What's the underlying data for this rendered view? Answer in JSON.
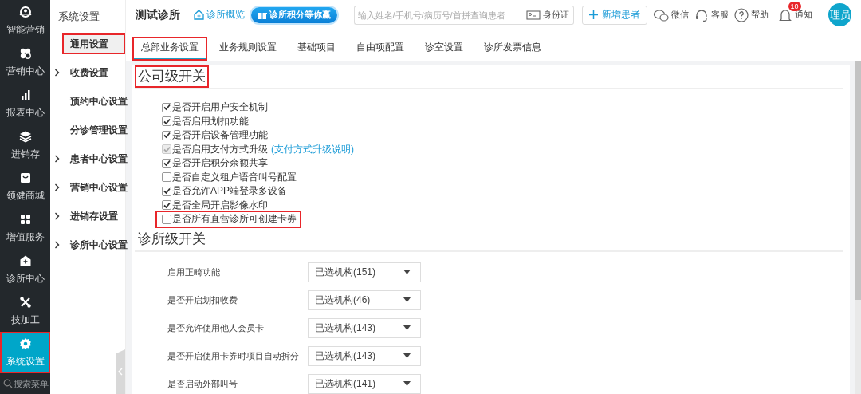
{
  "sidebar": {
    "items": [
      {
        "label": "智能营销",
        "selected": false,
        "highlighted": false
      },
      {
        "label": "营销中心",
        "selected": false,
        "highlighted": false
      },
      {
        "label": "报表中心",
        "selected": false,
        "highlighted": false
      },
      {
        "label": "进销存",
        "selected": false,
        "highlighted": false
      },
      {
        "label": "领健商城",
        "selected": false,
        "highlighted": false
      },
      {
        "label": "增值服务",
        "selected": false,
        "highlighted": false
      },
      {
        "label": "诊所中心",
        "selected": false,
        "highlighted": false
      },
      {
        "label": "技加工",
        "selected": false,
        "highlighted": false
      },
      {
        "label": "系统设置",
        "selected": true,
        "highlighted": true
      }
    ],
    "search": {
      "placeholder": "搜索菜单"
    }
  },
  "submenu": {
    "title": "系统设置",
    "items": [
      {
        "label": "通用设置",
        "expandable": false,
        "selected": true,
        "highlighted": true
      },
      {
        "label": "收费设置",
        "expandable": true,
        "selected": false,
        "highlighted": false
      },
      {
        "label": "预约中心设置",
        "expandable": false,
        "selected": false,
        "highlighted": false
      },
      {
        "label": "分诊管理设置",
        "expandable": false,
        "selected": false,
        "highlighted": false
      },
      {
        "label": "患者中心设置",
        "expandable": true,
        "selected": false,
        "highlighted": false
      },
      {
        "label": "营销中心设置",
        "expandable": true,
        "selected": false,
        "highlighted": false
      },
      {
        "label": "进销存设置",
        "expandable": true,
        "selected": false,
        "highlighted": false
      },
      {
        "label": "诊所中心设置",
        "expandable": true,
        "selected": false,
        "highlighted": false
      }
    ]
  },
  "topbar": {
    "clinic_name": "测试诊所",
    "overview_link": "诊所概览",
    "promo_banner": "诊所积分等你赢",
    "search": {
      "placeholder": "输入姓名/手机号/病历号/首拼查询患者"
    },
    "id_card_button": "身份证",
    "add_patient_button": "新增患者",
    "actions": [
      {
        "label": "微信"
      },
      {
        "label": "客服"
      },
      {
        "label": "帮助"
      },
      {
        "label": "通知",
        "badge": "10"
      }
    ],
    "avatar": "理员"
  },
  "tabs": [
    {
      "label": "总部业务设置",
      "selected": true,
      "highlighted": true
    },
    {
      "label": "业务规则设置",
      "selected": false,
      "highlighted": false
    },
    {
      "label": "基础项目",
      "selected": false,
      "highlighted": false
    },
    {
      "label": "自由项配置",
      "selected": false,
      "highlighted": false
    },
    {
      "label": "诊室设置",
      "selected": false,
      "highlighted": false
    },
    {
      "label": "诊所发票信息",
      "selected": false,
      "highlighted": false
    }
  ],
  "company_switches": {
    "title": "公司级开关",
    "highlighted": true,
    "items": [
      {
        "label": "是否开启用户安全机制",
        "checked": true,
        "disabled": false,
        "highlighted": false
      },
      {
        "label": "是否启用划扣功能",
        "checked": true,
        "disabled": false,
        "highlighted": false
      },
      {
        "label": "是否开启设备管理功能",
        "checked": true,
        "disabled": false,
        "highlighted": false
      },
      {
        "label": "是否启用支付方式升级",
        "link": "(支付方式升级说明)",
        "checked": true,
        "disabled": true,
        "highlighted": false
      },
      {
        "label": "是否开启积分余额共享",
        "checked": true,
        "disabled": false,
        "highlighted": false
      },
      {
        "label": "是否自定义租户语音叫号配置",
        "checked": false,
        "disabled": false,
        "highlighted": false
      },
      {
        "label": "是否允许APP端登录多设备",
        "checked": true,
        "disabled": false,
        "highlighted": false
      },
      {
        "label": "是否全局开启影像水印",
        "checked": true,
        "disabled": false,
        "highlighted": false
      },
      {
        "label": "是否所有直营诊所可创建卡券",
        "checked": false,
        "disabled": false,
        "highlighted": true
      }
    ]
  },
  "clinic_switches": {
    "title": "诊所级开关",
    "highlighted": false,
    "rows": [
      {
        "label": "启用正畸功能",
        "value": "已选机构(151)"
      },
      {
        "label": "是否开启划扣收费",
        "value": "已选机构(46)"
      },
      {
        "label": "是否允许使用他人会员卡",
        "value": "已选机构(143)"
      },
      {
        "label": "是否开启使用卡券时项目自动拆分",
        "value": "已选机构(143)"
      },
      {
        "label": "是否启动外部叫号",
        "value": "已选机构(141)"
      }
    ]
  }
}
